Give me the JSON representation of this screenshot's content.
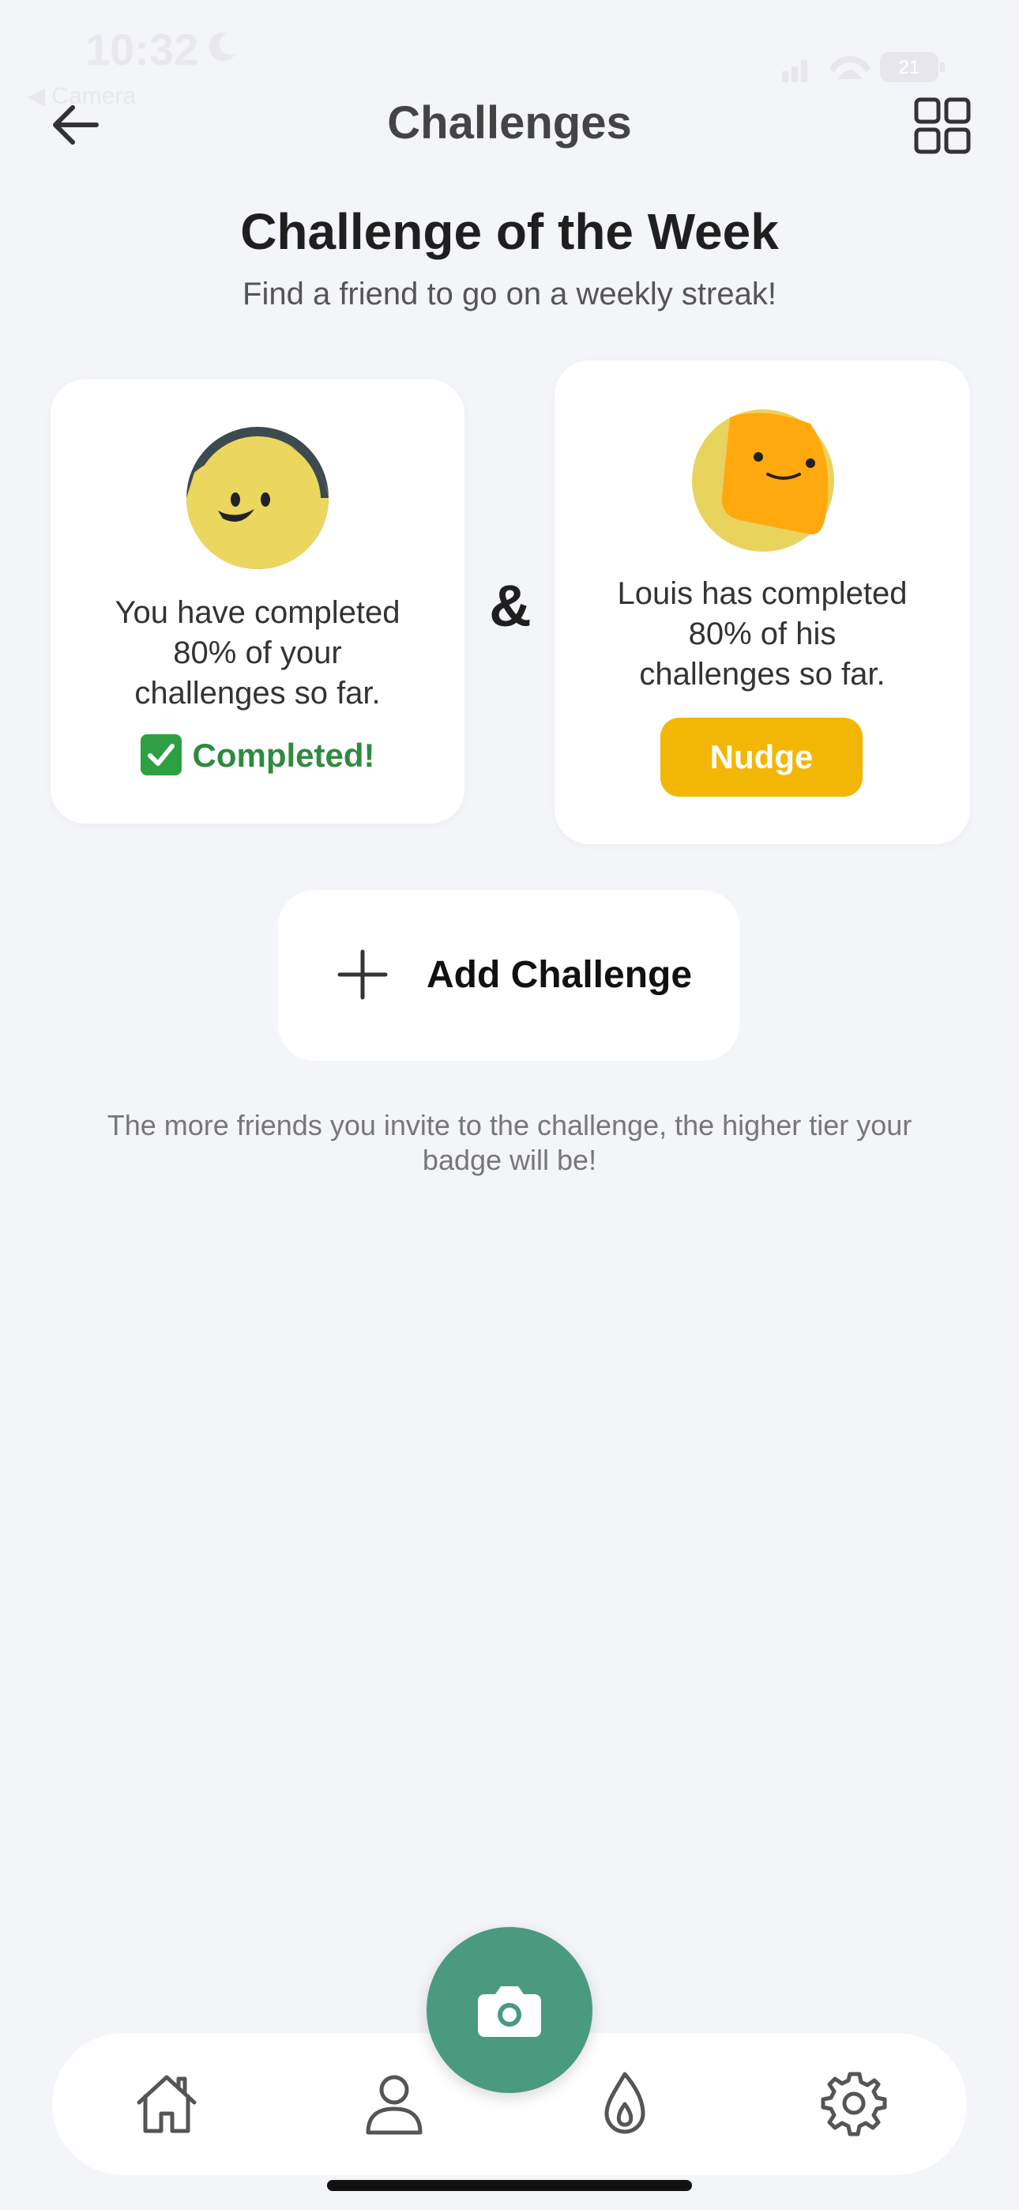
{
  "status_bar": {
    "time": "10:32",
    "back_app": "◀ Camera",
    "battery": "21"
  },
  "header": {
    "title": "Challenges"
  },
  "week": {
    "title": "Challenge of the Week",
    "subtitle": "Find a friend to go on a weekly streak!"
  },
  "me": {
    "line1": "You have completed",
    "line2": "80% of your",
    "line3": "challenges so far.",
    "status": "Completed!",
    "progress_percent": 80
  },
  "separator": "&",
  "louis": {
    "line1": "Louis has completed",
    "line2": "80% of his",
    "line3": "challenges so far.",
    "action": "Nudge",
    "progress_percent": 80
  },
  "add_challenge": {
    "label": "Add Challenge"
  },
  "footer_note": "The more friends you invite to the challenge, the higher tier your badge will be!",
  "nav": {
    "items": [
      "home-icon",
      "profile-icon",
      "camera-icon",
      "streak-icon",
      "settings-icon"
    ]
  },
  "colors": {
    "background": "#F4F5F9",
    "accent_green": "#4A9A80",
    "nudge_yellow": "#F2B705",
    "completed_green": "#2E8B3E"
  }
}
